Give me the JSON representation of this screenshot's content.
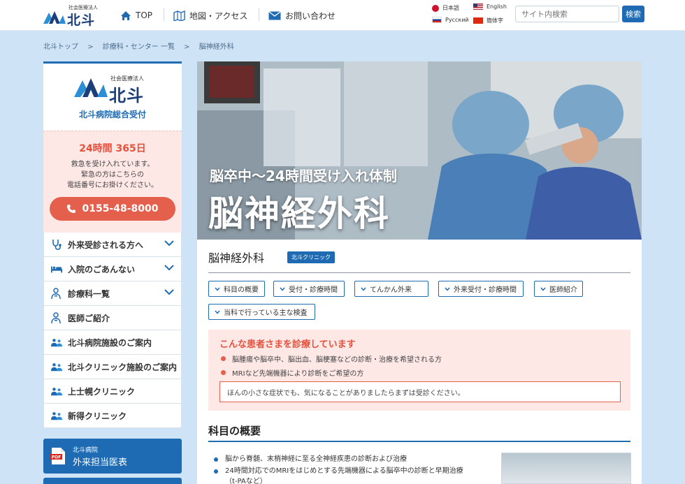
{
  "header": {
    "logo": {
      "corp": "社会医療法人",
      "name": "北斗"
    },
    "nav": [
      {
        "label": "TOP",
        "icon": "home-icon"
      },
      {
        "label": "地図・アクセス",
        "icon": "map-icon"
      },
      {
        "label": "お問い合わせ",
        "icon": "mail-icon"
      }
    ],
    "languages": [
      {
        "label": "日本語",
        "flag": "jp"
      },
      {
        "label": "English",
        "flag": "us"
      },
      {
        "label": "Русский",
        "flag": "ru"
      },
      {
        "label": "簡体字",
        "flag": "cn"
      }
    ],
    "search_placeholder": "サイト内検索",
    "search_button": "検索"
  },
  "breadcrumb": [
    "北斗トップ",
    ">",
    "診療科・センター 一覧",
    ">",
    "脳神経外科"
  ],
  "sidebar": {
    "logo": {
      "corp": "社会医療法人",
      "name": "北斗",
      "sub": "北斗病院総合受付"
    },
    "emergency": {
      "head": "24時間 365日",
      "lines": [
        "救急を受け入れています。",
        "緊急の方はこちらの",
        "電話番号にお掛けください。"
      ],
      "tel": "0155-48-8000"
    },
    "menu": [
      {
        "label": "外来受診される方へ",
        "icon": "stethoscope-icon",
        "chevron": true
      },
      {
        "label": "入院のごあんない",
        "icon": "bed-icon",
        "chevron": true
      },
      {
        "label": "診療科一覧",
        "icon": "doctor-icon",
        "chevron": true
      },
      {
        "label": "医師ご紹介",
        "icon": "doctor-icon",
        "chevron": false
      },
      {
        "label": "北斗病院施設のご案内",
        "icon": "people-icon",
        "chevron": false
      },
      {
        "label": "北斗クリニック施設のご案内",
        "icon": "people-icon",
        "chevron": false
      },
      {
        "label": "上士幌クリニック",
        "icon": "people-icon",
        "chevron": false
      },
      {
        "label": "新得クリニック",
        "icon": "people-icon",
        "chevron": false
      }
    ],
    "pdf": {
      "small": "北斗病院",
      "big": "外来担当医表"
    }
  },
  "main": {
    "hero": {
      "sub": "脳卒中～24時間受け入れ体制",
      "title": "脳神経外科"
    },
    "heading": "脳神経外科",
    "badge": "北斗クリニック",
    "anchors": [
      "科目の概要",
      "受付・診療時間",
      "てんかん外来",
      "外来受付・診療時間",
      "医師紹介",
      "当科で行っている主な検査"
    ],
    "patients": {
      "head": "こんな患者さまを診療しています",
      "items": [
        "脳腫瘍や脳卒中、脳出血、脳梗塞などの診断・治療を希望される方",
        "MRIなど先端機器により診断をご希望の方"
      ],
      "note": "ほんの小さな症状でも、気になることがありましたらまずは受診ください。"
    },
    "overview": {
      "heading": "科目の概要",
      "items": [
        "脳から脊髄、末梢神経に至る全神経疾患の診断および治療",
        "24時間対応でのMRIをはじめとする先端機器による脳卒中の診断と早期治療",
        "（t-PAなど）"
      ]
    }
  },
  "colors": {
    "accent": "#1f6bb3",
    "alert": "#e4513c",
    "pink_bg": "#fde8e6",
    "page_bg": "#cfe3f7"
  }
}
